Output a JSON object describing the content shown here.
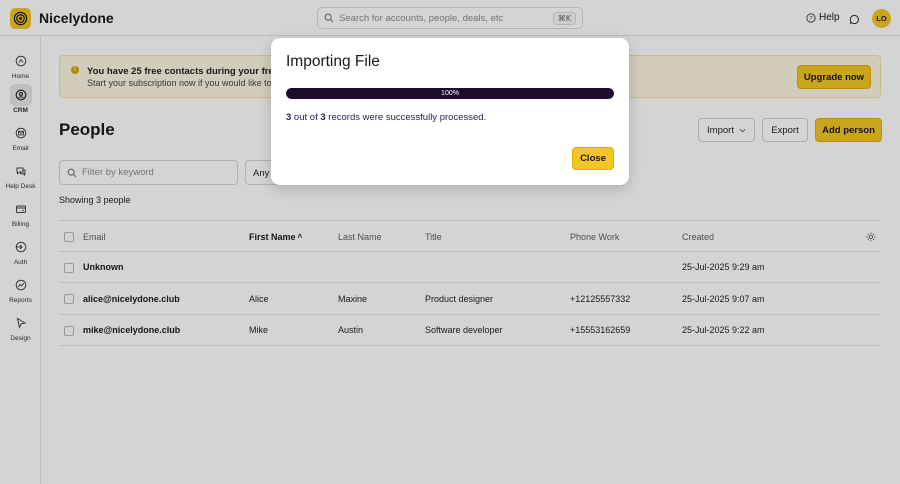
{
  "app": {
    "name": "Nicelydone",
    "logo_icon": "spiral-logo-icon",
    "brand_color": "#f3c623"
  },
  "search": {
    "placeholder": "Search for accounts, people, deals, etc",
    "shortcut": "⌘K"
  },
  "topbar": {
    "help_label": "Help",
    "avatar_initials": "LO"
  },
  "sidebar": {
    "items": [
      {
        "label": "Home",
        "icon": "home-icon",
        "active": false
      },
      {
        "label": "CRM",
        "icon": "crm-icon",
        "active": true
      },
      {
        "label": "Email",
        "icon": "email-icon",
        "active": false
      },
      {
        "label": "Help Desk",
        "icon": "help-desk-icon",
        "active": false
      },
      {
        "label": "Billing",
        "icon": "billing-icon",
        "active": false
      },
      {
        "label": "Auth",
        "icon": "auth-icon",
        "active": false
      },
      {
        "label": "Reports",
        "icon": "reports-icon",
        "active": false
      },
      {
        "label": "Design",
        "icon": "design-icon",
        "active": false
      }
    ]
  },
  "banner": {
    "line1": "You have 25 free contacts during your free trial.",
    "line2": "Start your subscription now if you would like to i",
    "button": "Upgrade now"
  },
  "page": {
    "title": "People",
    "import_label": "Import",
    "export_label": "Export",
    "add_label": "Add person",
    "filter_placeholder": "Filter by keyword",
    "any_filter": "Any f",
    "showing": "Showing 3 people"
  },
  "table": {
    "columns": {
      "email": "Email",
      "first_name": "First Name",
      "last_name": "Last Name",
      "title": "Title",
      "phone": "Phone Work",
      "created": "Created"
    },
    "sort_indicator": "˄",
    "rows": [
      {
        "email": "Unknown",
        "first_name": "",
        "last_name": "",
        "title": "",
        "phone": "",
        "created": "25-Jul-2025 9:29 am"
      },
      {
        "email": "alice@nicelydone.club",
        "first_name": "Alice",
        "last_name": "Maxine",
        "title": "Product designer",
        "phone": "+12125557332",
        "created": "25-Jul-2025 9:07 am"
      },
      {
        "email": "mike@nicelydone.club",
        "first_name": "Mike",
        "last_name": "Austin",
        "title": "Software developer",
        "phone": "+15553162659",
        "created": "25-Jul-2025 9:22 am"
      }
    ]
  },
  "modal": {
    "title": "Importing File",
    "progress_value": 1.0,
    "progress_label": "100%",
    "msg_count": "3",
    "msg_mid": " out of ",
    "msg_total": "3",
    "msg_tail": " records were successfully processed.",
    "close_label": "Close"
  }
}
